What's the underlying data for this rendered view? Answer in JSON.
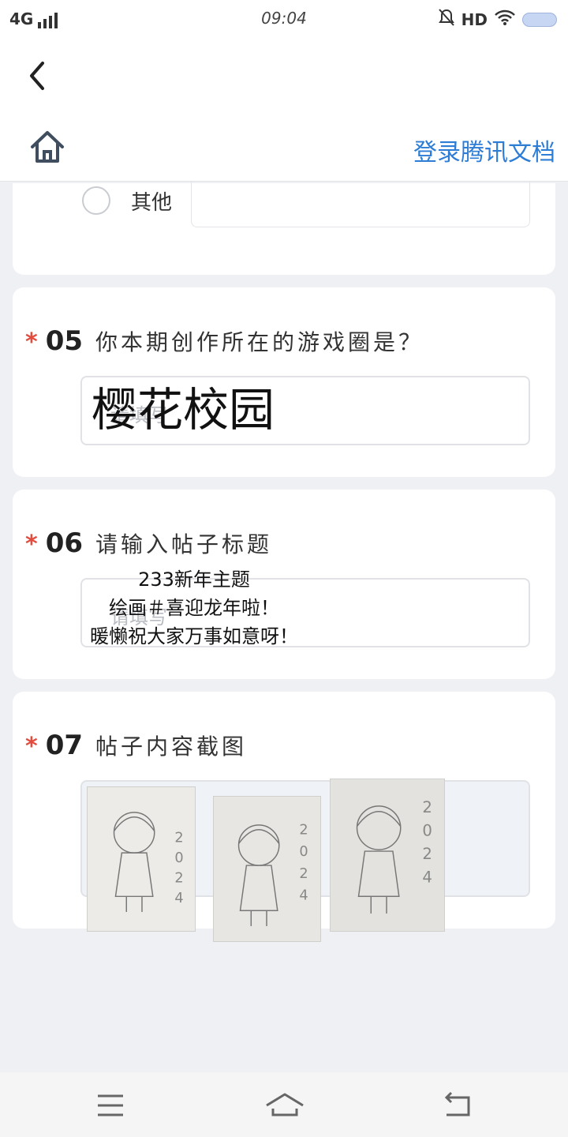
{
  "status_bar": {
    "network": "4G",
    "time": "09:04",
    "hd": "HD",
    "icons": [
      "signal-icon",
      "mute-bell-icon",
      "wifi-icon",
      "battery-icon"
    ]
  },
  "header": {
    "back_icon": "chevron-left-icon",
    "home_icon": "home-icon",
    "login_label": "登录腾讯文档"
  },
  "form": {
    "prev_option": {
      "label": "其他"
    },
    "questions": [
      {
        "required_mark": "*",
        "number": "05",
        "title": "你本期创作所在的游戏圈是？",
        "placeholder": "请填写",
        "answer": "樱花校园"
      },
      {
        "required_mark": "*",
        "number": "06",
        "title": "请输入帖子标题",
        "placeholder": "请填写",
        "answer_lines": [
          "233新年主题",
          "绘画＃喜迎龙年啦！",
          "暖懒祝大家万事如意呀！"
        ]
      },
      {
        "required_mark": "*",
        "number": "07",
        "title": "帖子内容截图",
        "images": [
          "drawing-1",
          "drawing-2",
          "drawing-3"
        ]
      }
    ]
  },
  "nav": {
    "icons": [
      "menu-icon",
      "home-nav-icon",
      "back-nav-icon"
    ]
  },
  "colors": {
    "accent": "#2d7cd6",
    "required": "#e24c3f",
    "background": "#eef0f4"
  }
}
